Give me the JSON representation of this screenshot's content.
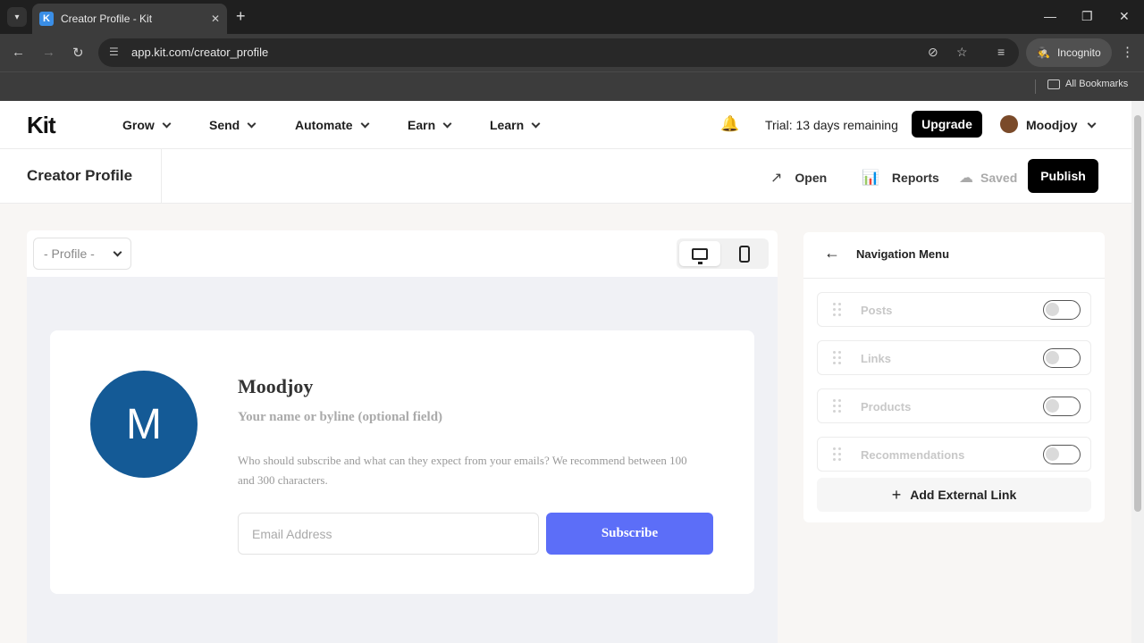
{
  "browser": {
    "tab_title": "Creator Profile - Kit",
    "tab_favicon": "K",
    "url": "app.kit.com/creator_profile",
    "incognito_label": "Incognito",
    "bookmarks_label": "All Bookmarks"
  },
  "header": {
    "logo": "Kit",
    "nav": [
      "Grow",
      "Send",
      "Automate",
      "Earn",
      "Learn"
    ],
    "trial": "Trial: 13 days remaining",
    "upgrade": "Upgrade",
    "user": "Moodjoy"
  },
  "subheader": {
    "title": "Creator Profile",
    "open": "Open",
    "reports": "Reports",
    "saved": "Saved",
    "publish": "Publish"
  },
  "preview": {
    "page_select": "- Profile -",
    "avatar_letter": "M",
    "name": "Moodjoy",
    "byline": "Your name or byline (optional field)",
    "description": "Who should subscribe and what can they expect from your emails? We recommend between 100 and 300 characters.",
    "email_placeholder": "Email Address",
    "subscribe": "Subscribe"
  },
  "panel": {
    "title": "Navigation Menu",
    "items": [
      {
        "label": "Posts",
        "enabled": false
      },
      {
        "label": "Links",
        "enabled": false
      },
      {
        "label": "Products",
        "enabled": false
      },
      {
        "label": "Recommendations",
        "enabled": false
      }
    ],
    "add_link": "Add External Link"
  },
  "colors": {
    "brand_dark": "#000000",
    "subscribe": "#5c6ef8",
    "avatar": "#145a96"
  }
}
